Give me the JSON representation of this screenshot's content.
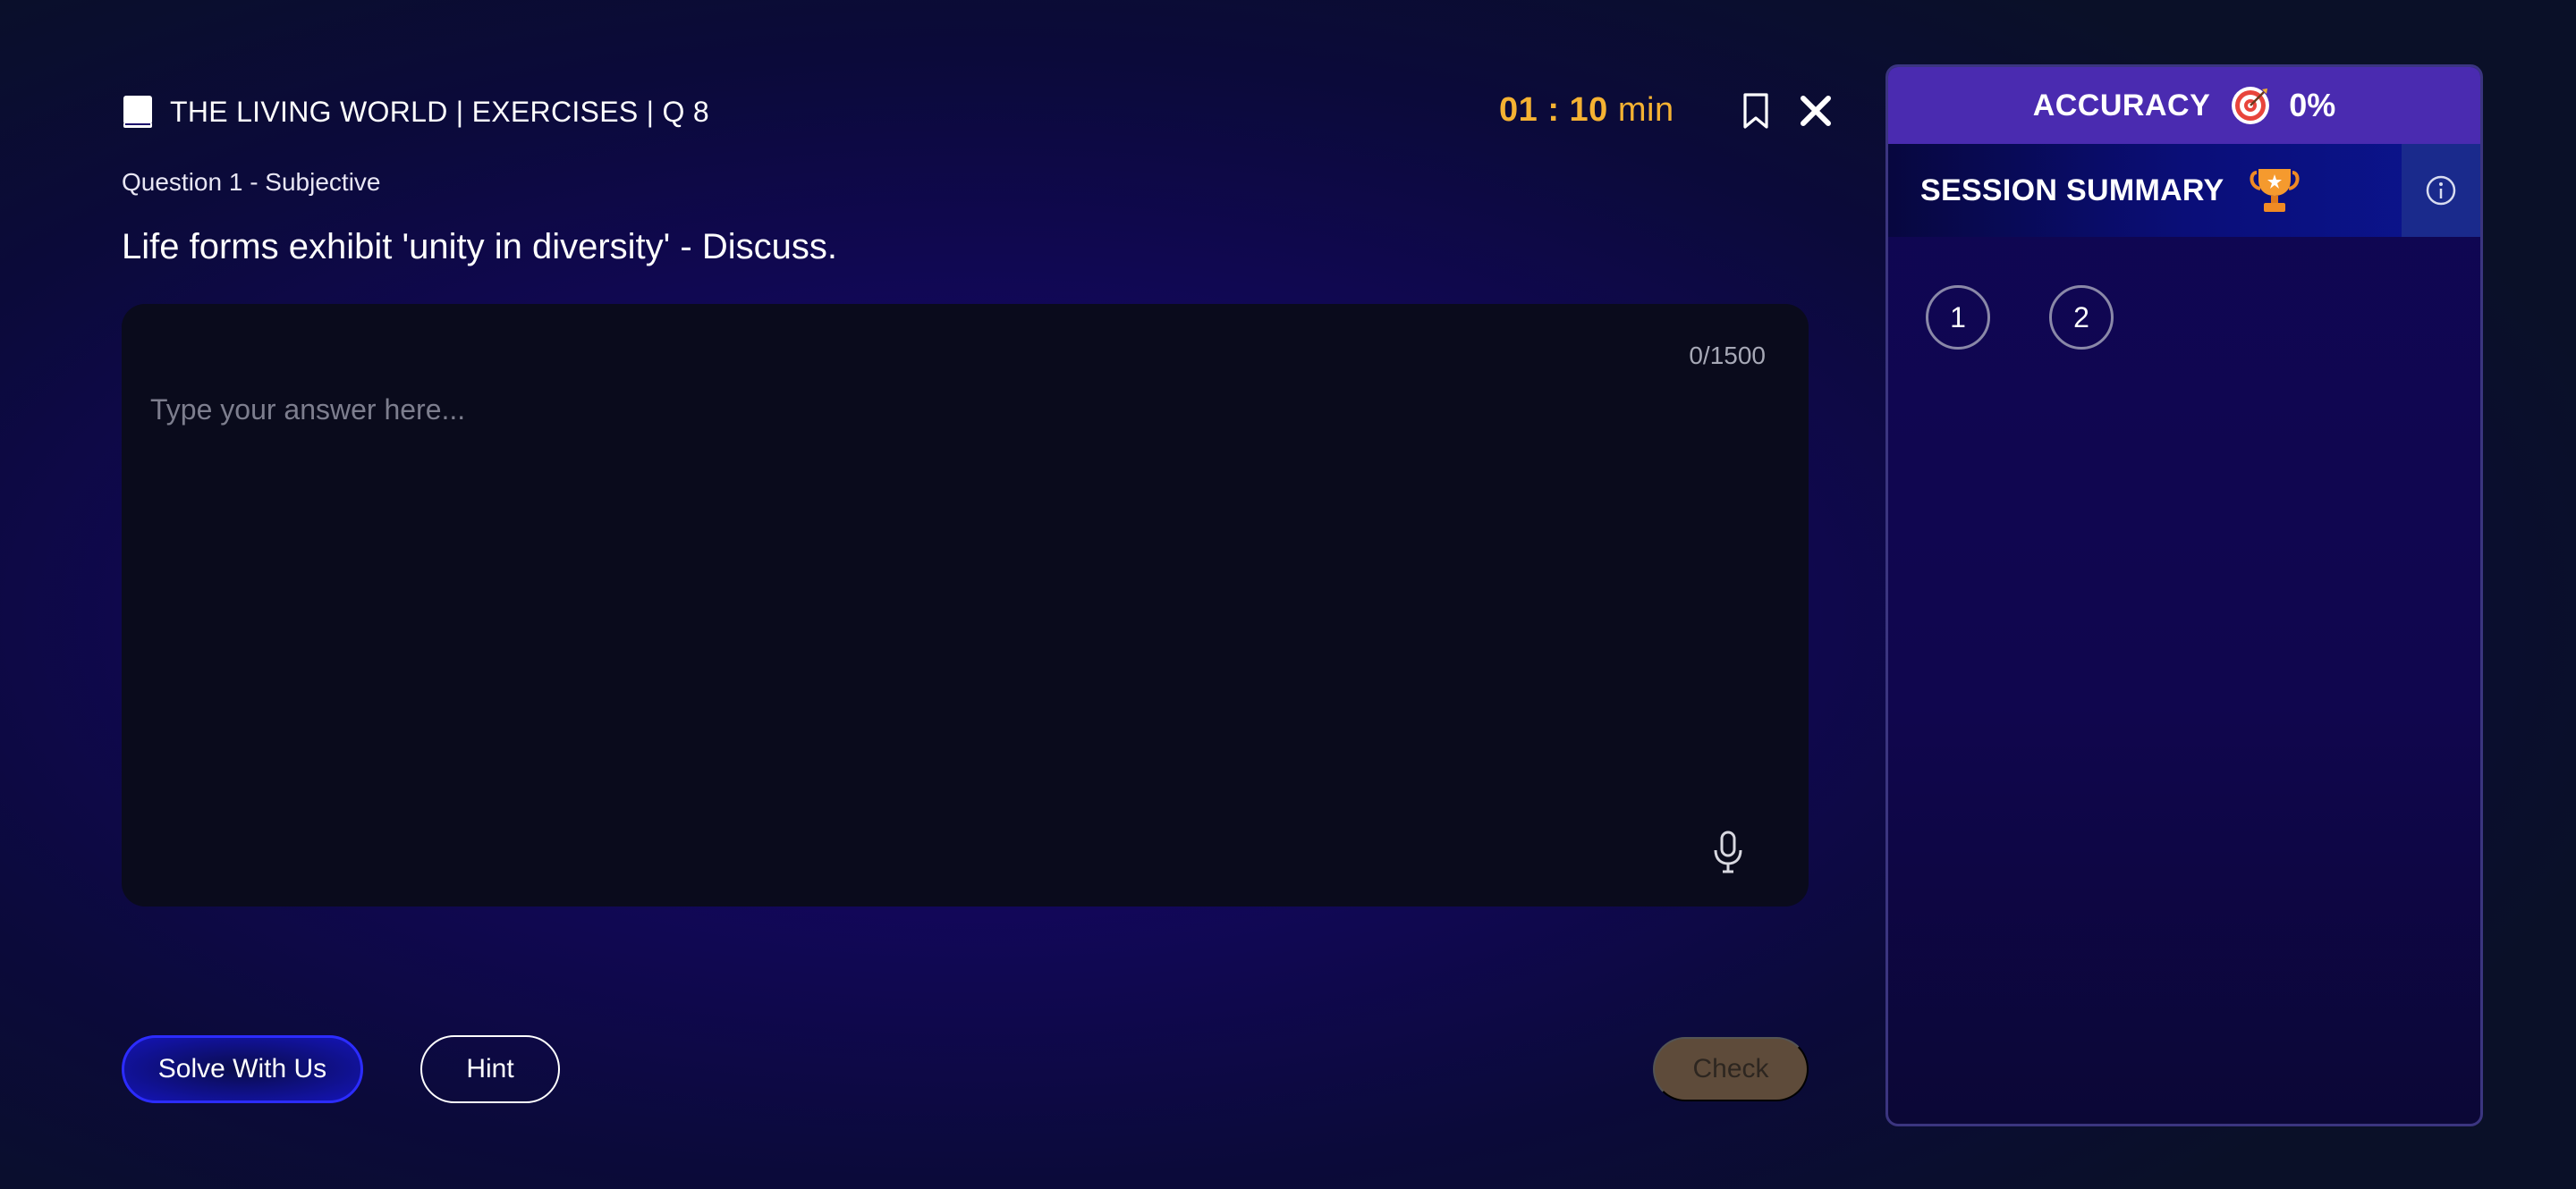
{
  "header": {
    "breadcrumb": "THE LIVING WORLD | EXERCISES | Q 8",
    "timer_value": "01 : 10",
    "timer_unit": "min",
    "icons": {
      "book": "book-icon",
      "bookmark": "bookmark-icon",
      "close": "close-icon"
    }
  },
  "question": {
    "label": "Question 1 - Subjective",
    "text": "Life forms exhibit 'unity in diversity' - Discuss."
  },
  "answer": {
    "placeholder": "Type your answer here...",
    "char_count": "0/1500",
    "icons": {
      "mic": "microphone-icon"
    }
  },
  "actions": {
    "solve_label": "Solve With Us",
    "hint_label": "Hint",
    "check_label": "Check"
  },
  "panel": {
    "accuracy_label": "ACCURACY",
    "accuracy_value": "0%",
    "summary_label": "SESSION SUMMARY",
    "icons": {
      "accuracy": "target-icon",
      "summary": "trophy-icon",
      "info": "info-icon"
    },
    "question_numbers": [
      "1",
      "2"
    ]
  },
  "colors": {
    "timer": "#f5b232",
    "accuracy_bar": "#4a2bb0",
    "solve_button_border": "#2c2cff",
    "check_button": "#5e4b3a"
  }
}
